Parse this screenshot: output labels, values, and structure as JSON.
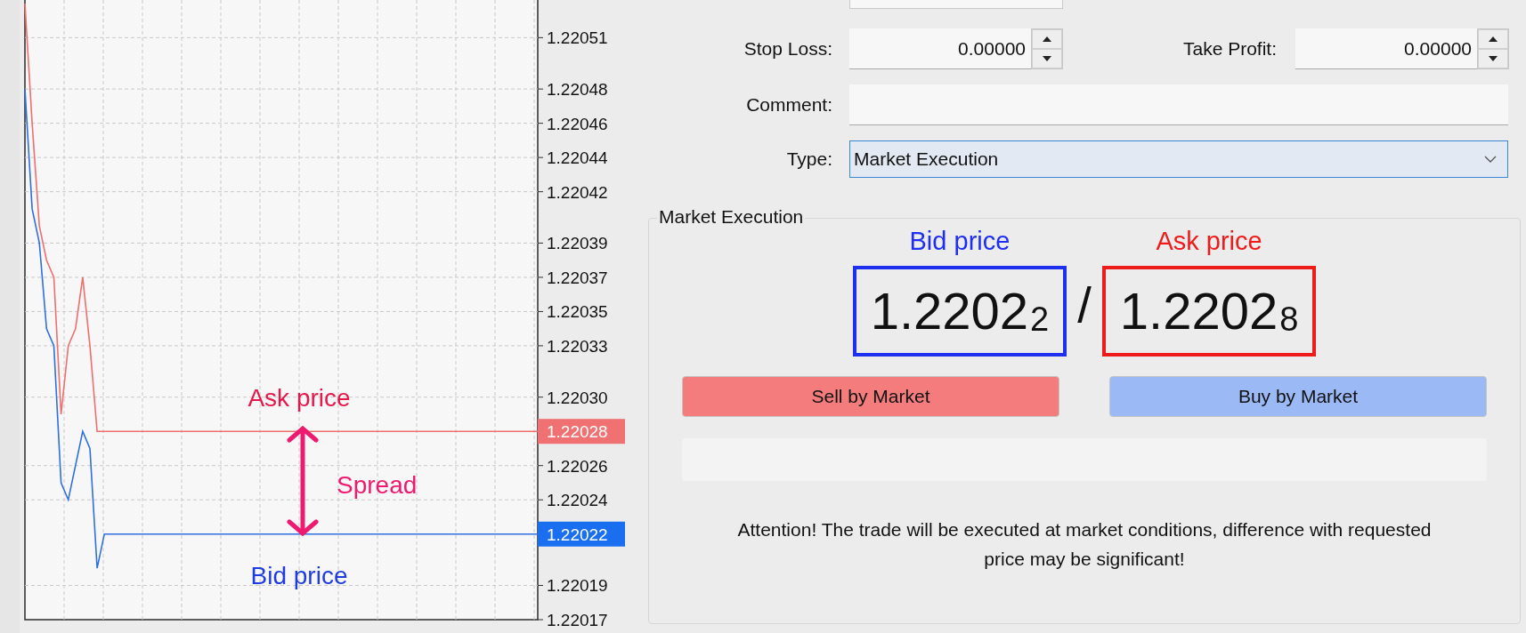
{
  "chart": {
    "chart_data": {
      "type": "line",
      "grid": true,
      "categories": [
        null,
        null,
        null,
        null,
        null,
        null,
        null,
        null,
        null,
        null,
        null,
        null,
        null,
        null,
        null,
        null,
        null,
        null,
        null,
        null,
        null,
        null,
        null,
        null,
        null,
        null,
        null,
        null,
        null,
        null,
        null,
        null,
        null,
        null,
        null,
        null,
        null,
        null,
        null,
        null,
        null,
        null,
        null,
        null,
        null,
        null,
        null,
        null,
        null,
        null,
        null,
        null,
        null,
        null,
        null,
        null,
        null,
        null,
        null,
        null,
        null,
        null,
        null,
        null,
        null,
        null,
        null,
        null,
        null,
        null,
        null,
        null
      ],
      "ylim": [
        1.22017,
        1.220532
      ],
      "yticks": [
        {
          "value": 1.22051,
          "label": "1.22051"
        },
        {
          "value": 1.22048,
          "label": "1.22048"
        },
        {
          "value": 1.22046,
          "label": "1.22046"
        },
        {
          "value": 1.22044,
          "label": "1.22044"
        },
        {
          "value": 1.22042,
          "label": "1.22042"
        },
        {
          "value": 1.22039,
          "label": "1.22039"
        },
        {
          "value": 1.22037,
          "label": "1.22037"
        },
        {
          "value": 1.22035,
          "label": "1.22035"
        },
        {
          "value": 1.22033,
          "label": "1.22033"
        },
        {
          "value": 1.2203,
          "label": "1.22030"
        },
        {
          "value": 1.22026,
          "label": "1.22026"
        },
        {
          "value": 1.22024,
          "label": "1.22024"
        },
        {
          "value": 1.22019,
          "label": "1.22019"
        },
        {
          "value": 1.22017,
          "label": "1.22017"
        }
      ],
      "series": [
        {
          "color": "#ef6f6f",
          "values": [
            1.22053,
            1.22046,
            1.2204,
            1.22038,
            1.22037,
            1.22029,
            1.22033,
            1.22034,
            1.22037,
            1.22033,
            1.22028,
            1.22028,
            1.22028,
            1.22028,
            1.22028,
            1.22028,
            1.22028,
            1.22028,
            1.22028,
            1.22028,
            1.22028,
            1.22028,
            1.22028,
            1.22028,
            1.22028,
            1.22028,
            1.22028,
            1.22028,
            1.22028,
            1.22028,
            1.22028,
            1.22028,
            1.22028,
            1.22028,
            1.22028,
            1.22028,
            1.22028,
            1.22028,
            1.22028,
            1.22028,
            1.22028,
            1.22028,
            1.22028,
            1.22028,
            1.22028,
            1.22028,
            1.22028,
            1.22028,
            1.22028,
            1.22028,
            1.22028,
            1.22028,
            1.22028,
            1.22028,
            1.22028,
            1.22028,
            1.22028,
            1.22028,
            1.22028,
            1.22028,
            1.22028,
            1.22028,
            1.22028,
            1.22028,
            1.22028,
            1.22028,
            1.22028,
            1.22028,
            1.22028,
            1.22028,
            1.22028,
            1.22028
          ]
        },
        {
          "color": "#2f6fe0",
          "values": [
            1.22048,
            1.22041,
            1.22039,
            1.22034,
            1.22033,
            1.22025,
            1.22024,
            1.22026,
            1.22028,
            1.22027,
            1.2202,
            1.22022,
            1.22022,
            1.22022,
            1.22022,
            1.22022,
            1.22022,
            1.22022,
            1.22022,
            1.22022,
            1.22022,
            1.22022,
            1.22022,
            1.22022,
            1.22022,
            1.22022,
            1.22022,
            1.22022,
            1.22022,
            1.22022,
            1.22022,
            1.22022,
            1.22022,
            1.22022,
            1.22022,
            1.22022,
            1.22022,
            1.22022,
            1.22022,
            1.22022,
            1.22022,
            1.22022,
            1.22022,
            1.22022,
            1.22022,
            1.22022,
            1.22022,
            1.22022,
            1.22022,
            1.22022,
            1.22022,
            1.22022,
            1.22022,
            1.22022,
            1.22022,
            1.22022,
            1.22022,
            1.22022,
            1.22022,
            1.22022,
            1.22022,
            1.22022,
            1.22022,
            1.22022,
            1.22022,
            1.22022,
            1.22022,
            1.22022,
            1.22022,
            1.22022,
            1.22022,
            1.22022
          ]
        }
      ]
    },
    "price_tags": [
      {
        "text": "1.22028",
        "color": "#f07171"
      },
      {
        "text": "1.22022",
        "color": "#1a6ff0"
      }
    ],
    "callouts": [
      {
        "text": "Ask price",
        "color": "#e6174a"
      },
      {
        "text": "Spread",
        "color": "#ee1a70"
      },
      {
        "text": "Bid price",
        "color": "#1f3ce0"
      }
    ]
  },
  "form": {
    "stop_loss": {
      "label": "Stop Loss:",
      "value": "0.00000"
    },
    "take_profit": {
      "label": "Take Profit:",
      "value": "0.00000"
    },
    "comment": {
      "label": "Comment:"
    },
    "type": {
      "label": "Type:",
      "value": "Market Execution"
    }
  },
  "execution": {
    "title": "Market Execution",
    "prices": [
      {
        "label": "Bid price",
        "main": "1.2202",
        "pip": "2",
        "color": "#1e2ff0"
      },
      {
        "label": "Ask price",
        "main": "1.2202",
        "pip": "8",
        "color": "#ee1b1b"
      }
    ],
    "separator": "/",
    "buttons": [
      {
        "label": "Sell by Market",
        "kind": "sell"
      },
      {
        "label": "Buy by Market",
        "kind": "buy"
      }
    ],
    "notice": "Attention! The trade will be executed at market conditions, difference with requested price may be significant!"
  }
}
